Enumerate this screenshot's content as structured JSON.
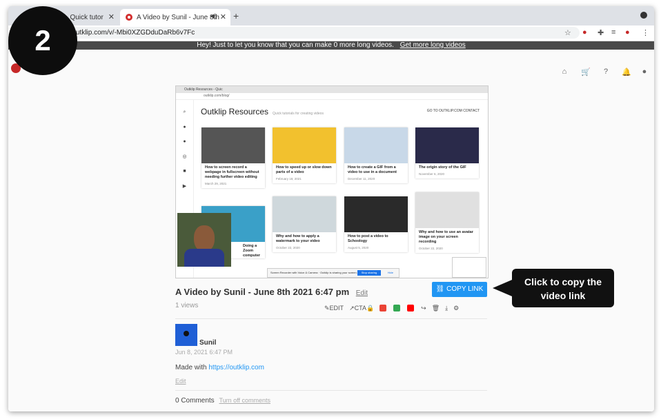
{
  "step_badge": "2",
  "browser": {
    "tab1_title": "…es - Quick tutor",
    "tab2_title": "A Video by Sunil - June 8th",
    "new_tab_icon": "+",
    "url": "utklip.com/v/-Mbi0XZGDduDaRb6v7Fc"
  },
  "banner": {
    "text": "Hey! Just to let you know that you can make 0 more long videos.",
    "link": "Get more long videos"
  },
  "video_preview": {
    "tab_title": "Outklip Resources - Quic",
    "url": "outklip.com/blog/",
    "site_title": "Outklip Resources",
    "tagline": "Quick tutorials for creating videos",
    "nav_links": "GO TO OUTKLIP.COM    CONTACT",
    "cards": [
      {
        "title": "How to screen record a webpage in fullscreen without needing further video editing",
        "date": "March 29, 2021",
        "color": "#555555"
      },
      {
        "title": "How to speed up or slow down parts of a video",
        "date": "February 18, 2021",
        "color": "#f2c12e"
      },
      {
        "title": "How to create a GIF from a video to use in a document",
        "date": "December 11, 2020",
        "color": "#c8d8e8"
      },
      {
        "title": "The origin story of the GIF",
        "date": "November 6, 2020",
        "color": "#2a2a4a"
      },
      {
        "title": "Doing a Zoom computer",
        "date": "",
        "color": "#3aa0c8"
      },
      {
        "title": "Why and how to apply a watermark to your video",
        "date": "October 22, 2020",
        "color": "#cfd8dc"
      },
      {
        "title": "How to post a video to Schoology",
        "date": "August 5, 2020",
        "color": "#2a2a2a"
      },
      {
        "title": "Why and how to use an avatar image on your screen recording",
        "date": "October 22, 2020",
        "color": "#e0e0e0"
      }
    ],
    "sharing_bar": "Screen Recorder with Voice & Camera · Outklip is sharing your screen.",
    "stop_sharing": "Stop sharing",
    "hide": "Hide"
  },
  "video_title": "A Video by Sunil - June 8th 2021 6:47 pm",
  "edit_link": "Edit",
  "views": "1 views",
  "copy_link_button": "COPY LINK",
  "callout": "Click to copy the video link",
  "actions": {
    "edit": "EDIT",
    "cta": "CTA"
  },
  "author": "Sunil",
  "date": "Jun 8, 2021 6:47 PM",
  "made_with": "Made with",
  "made_with_link": "https://outklip.com",
  "edit2": "Edit",
  "comments": "0 Comments",
  "turn_off_comments": "Turn off comments",
  "colors": {
    "accent": "#2196f3",
    "brand": "#c62828"
  }
}
